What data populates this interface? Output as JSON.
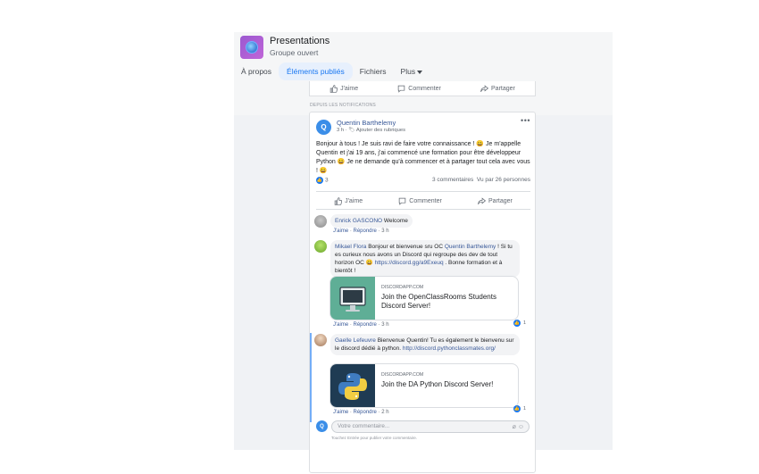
{
  "group": {
    "name": "Presentations",
    "privacy": "Groupe ouvert"
  },
  "tabs": [
    {
      "label": "À propos"
    },
    {
      "label": "Éléments publiés",
      "active": true
    },
    {
      "label": "Fichiers"
    },
    {
      "label": "Plus"
    }
  ],
  "actions": {
    "like": "J'aime",
    "comment": "Commenter",
    "share": "Partager"
  },
  "section_label": "DEPUIS LES NOTIFICATIONS",
  "post": {
    "author": "Quentin Barthelemy",
    "author_initial": "Q",
    "time": "3 h ·",
    "topic": "Ajouter des rubriques",
    "more": "•••",
    "body": "Bonjour à tous ! Je suis ravi de faire votre connaissance ! 😀 Je m'appelle Quentin et j'ai 19 ans, j'ai commencé une formation pour être développeur Python 😀 Je ne demande qu'à commencer et à partager tout cela avec vous ! 😀",
    "like_count": "3",
    "comments_count": "3 commentaires",
    "views": "Vu par 26 personnes"
  },
  "comments": [
    {
      "author": "Enrick GASCONO",
      "text": "Welcome",
      "actions": {
        "like": "J'aime",
        "reply": "Répondre",
        "time": "3 h"
      }
    },
    {
      "author": "Mikael Flora",
      "text_before": "Bonjour et bienvenue sru OC",
      "mention": "Quentin Barthelemy",
      "text_after": "! Si tu es curieux nous avons un Discord qui regroupe des dev de tout horizon OC 😀",
      "link": "https://discord.gg/a9Exeuq",
      "text_end": ". Bonne formation et à bientôt !",
      "card": {
        "domain": "DISCORDAPP.COM",
        "title": "Join the OpenClassRooms Students Discord Server!"
      },
      "reactions": "1",
      "actions": {
        "like": "J'aime",
        "reply": "Répondre",
        "time": "3 h"
      }
    },
    {
      "author": "Gaelle Lefeuvre",
      "text": "Bienvenue Quentin! Tu es également le bienvenu sur le discord dédié à python.",
      "link": "http://discord.pythonclassmates.org/",
      "card": {
        "domain": "DISCORDAPP.COM",
        "title": "Join the DA Python Discord Server!"
      },
      "reactions": "1",
      "actions": {
        "like": "J'aime",
        "reply": "Répondre",
        "time": "2 h"
      }
    }
  ],
  "compose": {
    "placeholder": "Votre commentaire...",
    "hint": "Touchez Entrée pour publier votre commentaire.",
    "avatar_initial": "Q"
  },
  "colors": {
    "accent": "#1877f2",
    "link": "#385898",
    "monitor_bg": "#5fae96",
    "python_bg": "#1f3b53"
  }
}
